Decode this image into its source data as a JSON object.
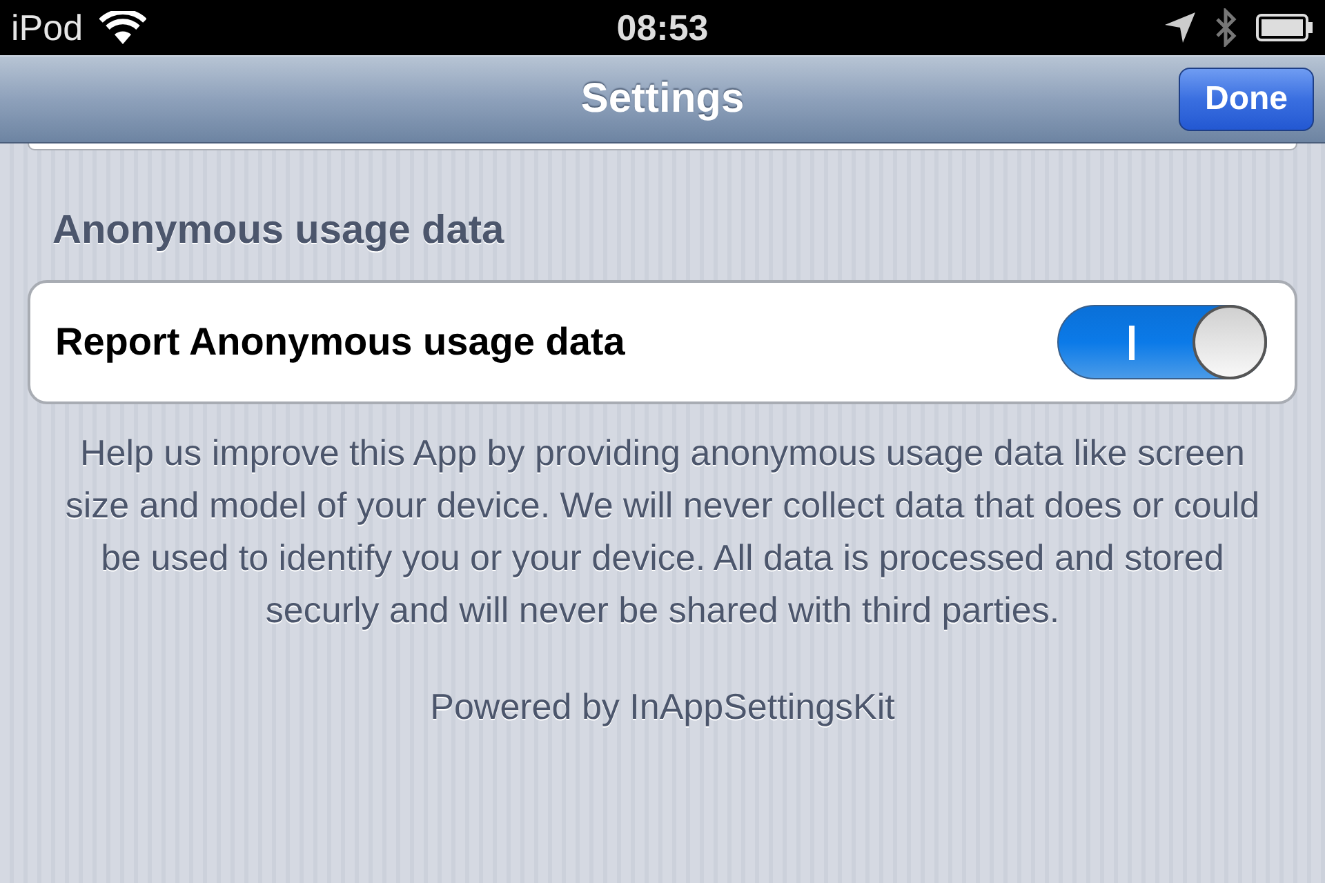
{
  "status_bar": {
    "carrier": "iPod",
    "time": "08:53"
  },
  "nav_bar": {
    "title": "Settings",
    "done_button": "Done"
  },
  "section": {
    "header": "Anonymous usage data",
    "rows": [
      {
        "kind": "toggle",
        "label": "Report Anonymous usage data",
        "on": true
      }
    ],
    "footer": "Help us improve this App by providing anonymous usage data like screen size and model of your device. We will never collect data that does or could be used to identify you or your device. All data is processed and stored securly and will never be shared with third parties."
  },
  "credit": "Powered by InAppSettingsKit"
}
